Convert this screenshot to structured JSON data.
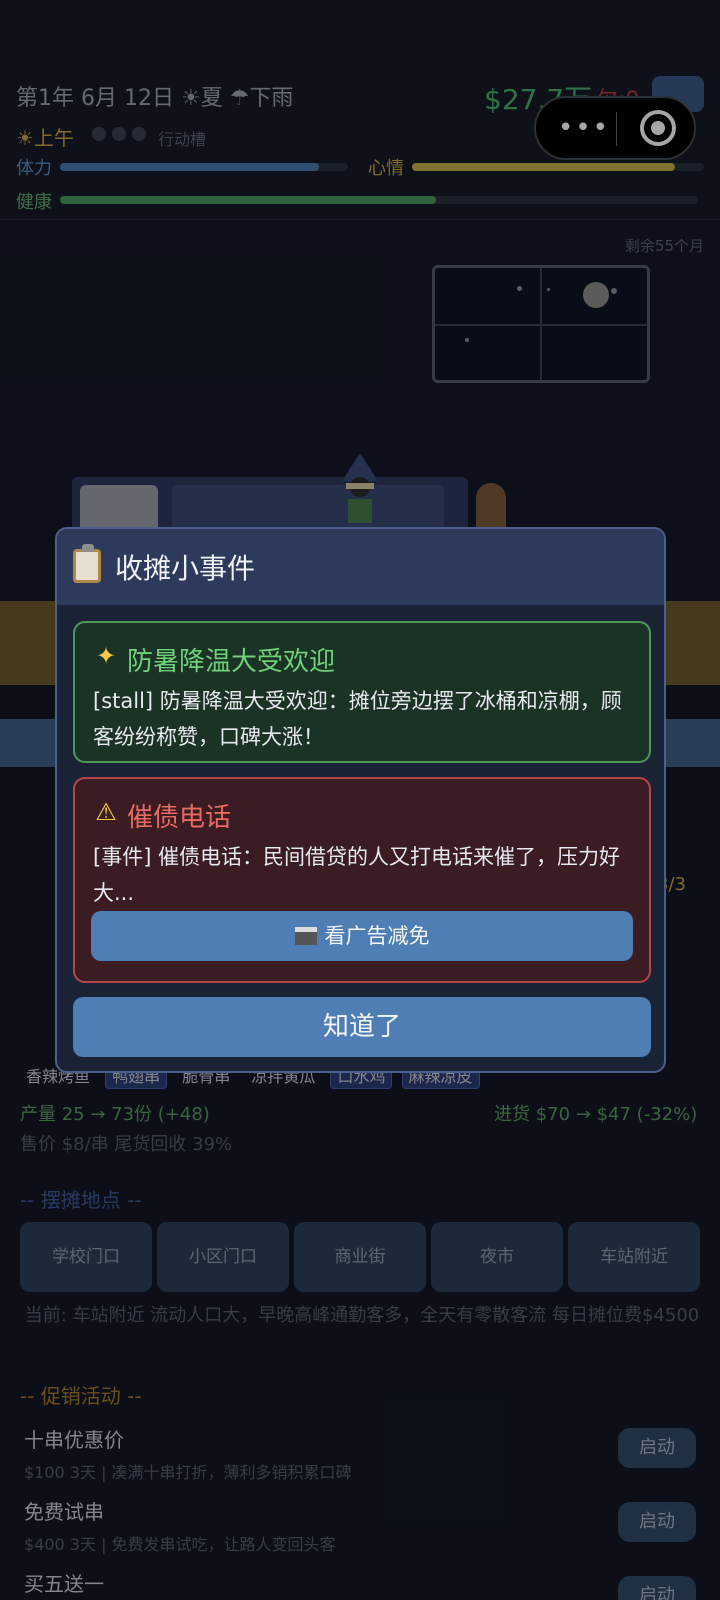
{
  "hud": {
    "date": "第1年 6月 12日 ☀夏 ☂下雨",
    "money": "$27.7万",
    "debt": "欠:0",
    "period": "☀上午",
    "slots_label": "行动槽",
    "stamina_label": "体力",
    "mood_label": "心情",
    "health_label": "健康",
    "stamina_level": 0.9,
    "mood_level": 0.9,
    "health_level": 0.59,
    "stamina_color": "#4a7ab0",
    "mood_color": "#c8b04a",
    "health_color": "#4c9a5a"
  },
  "scene": {
    "months_left": "剩余55个月"
  },
  "modal": {
    "title": "收摊小事件",
    "good_event": {
      "icon": "sparkles",
      "title": "防暑降温大受欢迎",
      "body": "[stall] 防暑降温大受欢迎：摊位旁边摆了冰桶和凉棚，顾客纷纷称赞，口碑大涨！"
    },
    "bad_event": {
      "icon": "warning",
      "title": "催债电话",
      "body": "[事件] 催债电话：民间借贷的人又打电话来催了，压力好大...",
      "ad_button": "看广告减免"
    },
    "ok_button": "知道了"
  },
  "background_panel": {
    "counter": "3/3",
    "dishes": [
      "香辣烤鱼",
      "鸭翅串",
      "脆骨串",
      "凉拌黄瓜",
      "口水鸡",
      "麻辣凉皮"
    ],
    "output": "产量 25 → 73份 (+48)",
    "purchase": "进货 $70 → $47 (-32%)",
    "price": "售价 $8/串  尾货回收 39%",
    "locations_title": "-- 摆摊地点 --",
    "locations": [
      "学校门口",
      "小区门口",
      "商业街",
      "夜市",
      "车站附近"
    ],
    "current_location": "当前: 车站附近  流动人口大，早晚高峰通勤客多，全天有零散客流  每日摊位费$4500",
    "promo_title": "-- 促销活动 --",
    "promos": [
      {
        "title": "十串优惠价",
        "desc": "$100 3天 | 凑满十串打折，薄利多销积累口碑",
        "button": "启动"
      },
      {
        "title": "免费试串",
        "desc": "$400 3天 | 免费发串试吃，让路人变回头客",
        "button": "启动"
      },
      {
        "title": "买五送一",
        "desc": "",
        "button": "启动"
      }
    ]
  }
}
